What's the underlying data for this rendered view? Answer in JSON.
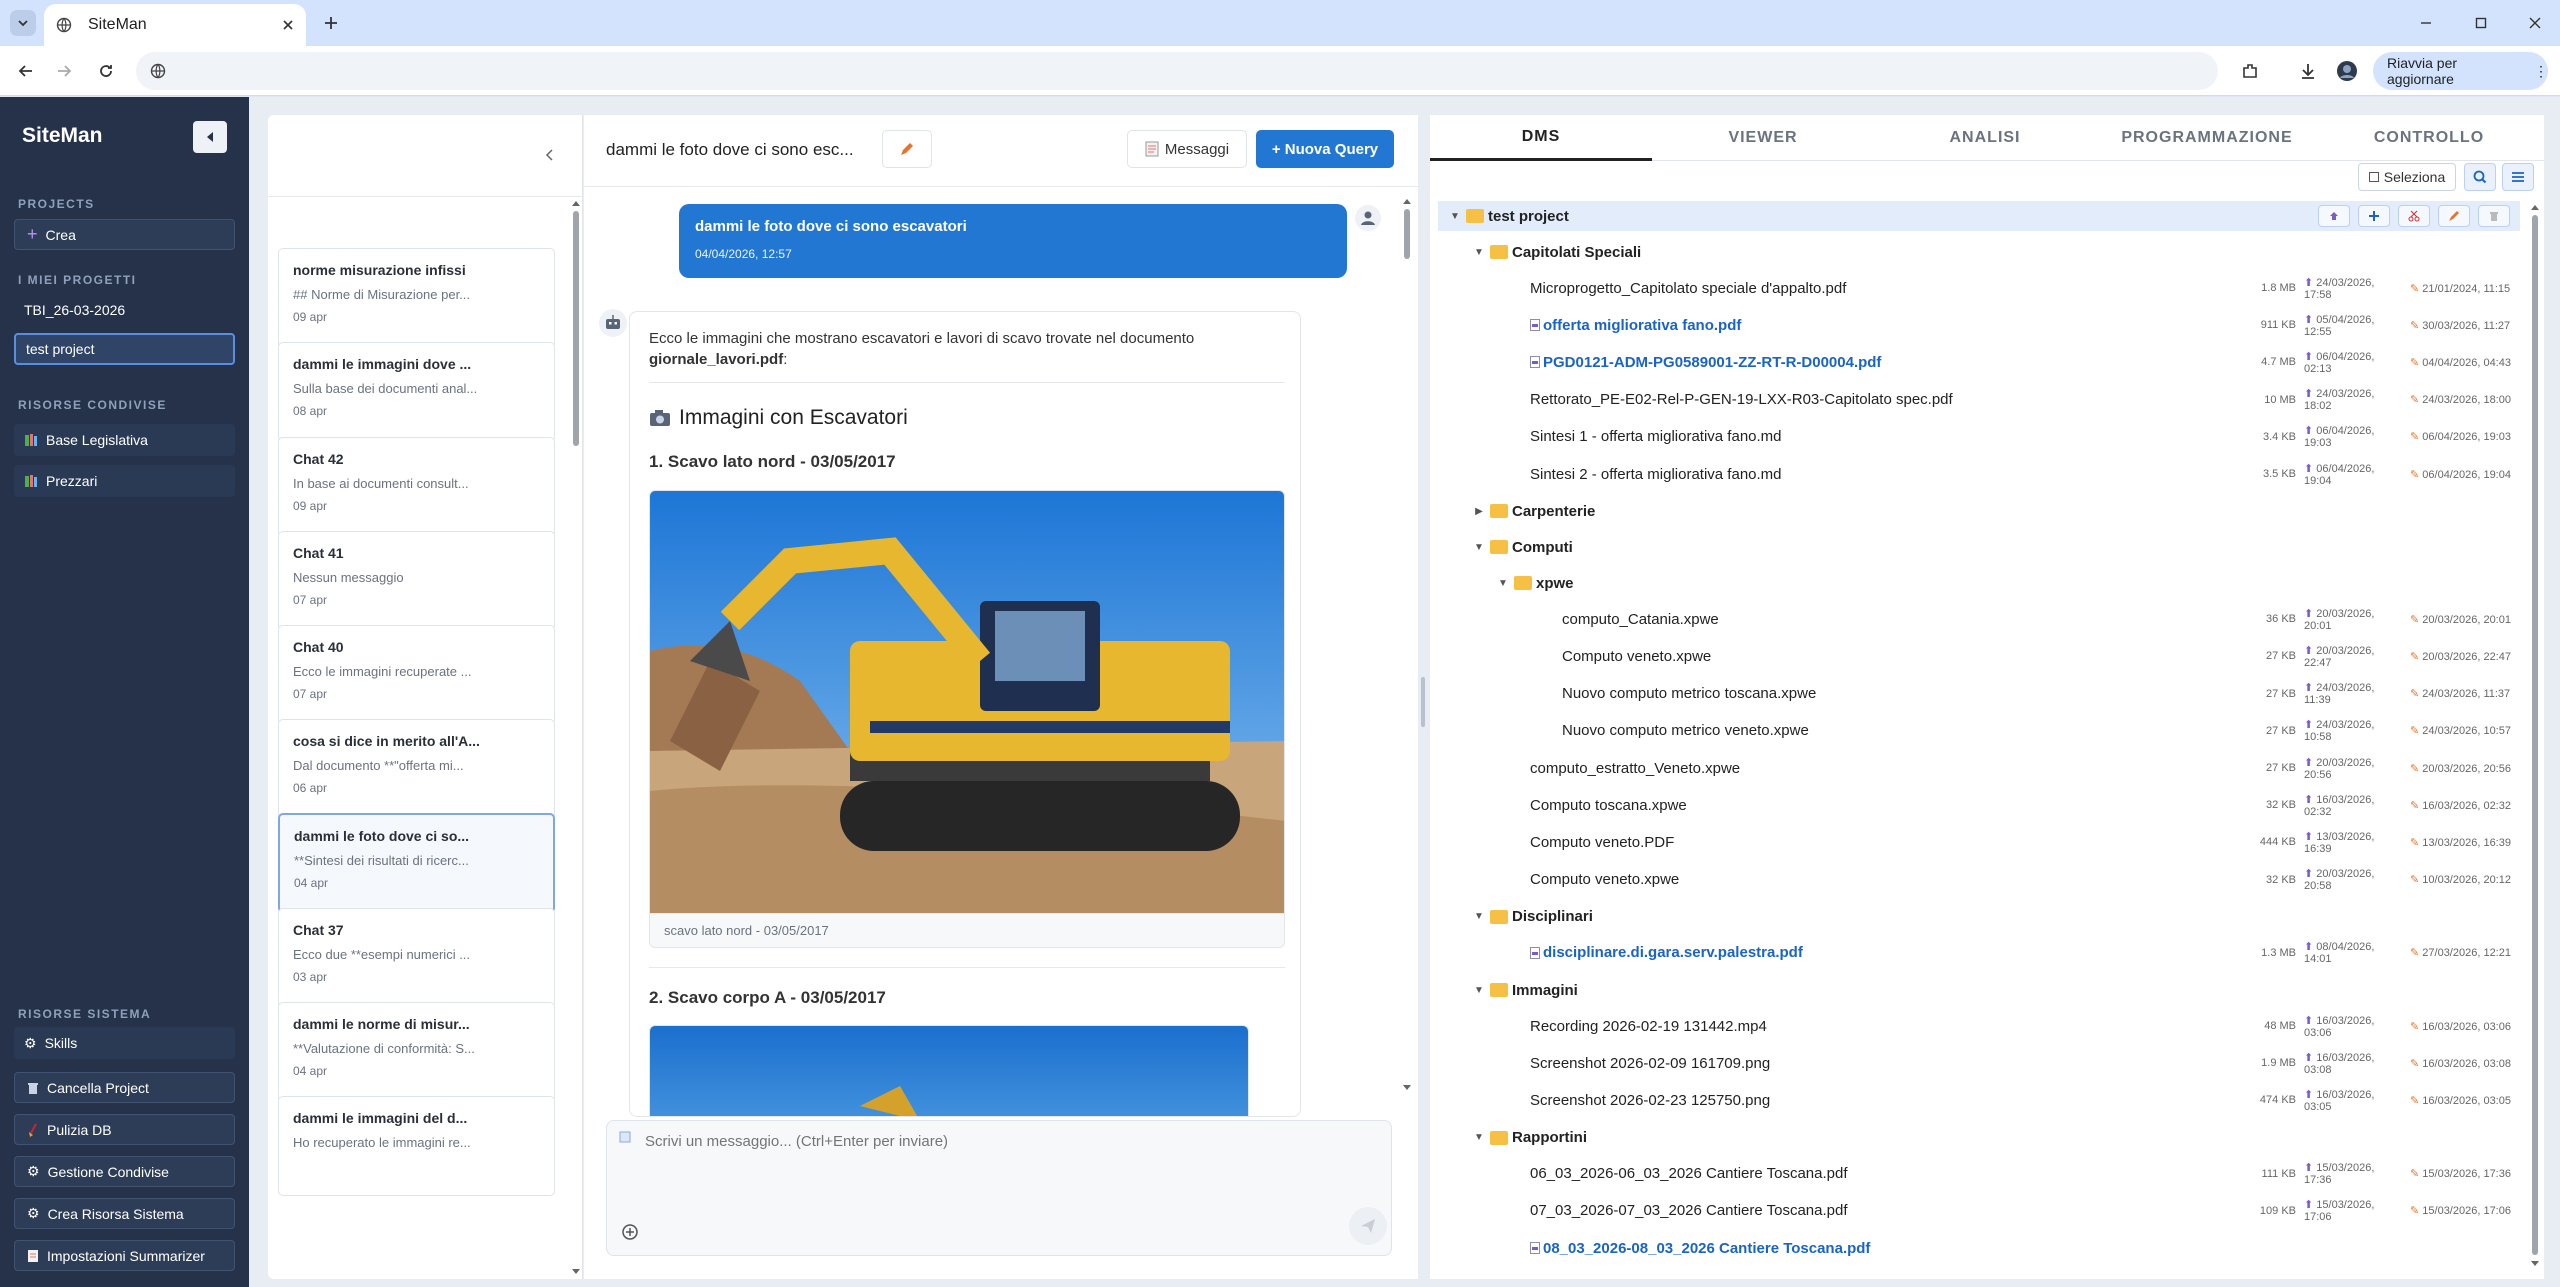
{
  "browser": {
    "tab_title": "SiteMan",
    "relaunch_label": "Riavvia per aggiornare",
    "address": ""
  },
  "sidebar": {
    "brand": "SiteMan",
    "projects_label": "PROJECTS",
    "create_label": "Crea",
    "my_projects_label": "I MIEI PROGETTI",
    "projects": [
      "TBI_26-03-2026",
      "test project"
    ],
    "shared_label": "RISORSE CONDIVISE",
    "shared": [
      "Base Legislativa",
      "Prezzari"
    ],
    "system_label": "RISORSE SISTEMA",
    "system": [
      "Skills",
      "Cancella Project",
      "Pulizia DB",
      "Gestione Condivise",
      "Crea Risorsa Sistema",
      "Impostazioni Summarizer"
    ]
  },
  "chats": [
    {
      "title": "norme misurazione infissi",
      "preview": "## Norme di Misurazione per...",
      "date": "09 apr"
    },
    {
      "title": "dammi le immagini dove ...",
      "preview": "Sulla base dei documenti anal...",
      "date": "08 apr"
    },
    {
      "title": "Chat 42",
      "preview": "In base ai documenti consult...",
      "date": "09 apr"
    },
    {
      "title": "Chat 41",
      "preview": "Nessun messaggio",
      "date": "07 apr"
    },
    {
      "title": "Chat 40",
      "preview": "Ecco le immagini recuperate ...",
      "date": "07 apr"
    },
    {
      "title": "cosa si dice in merito all'A...",
      "preview": "Dal documento **\"offerta mi...",
      "date": "06 apr"
    },
    {
      "title": "dammi le foto dove ci so...",
      "preview": "**Sintesi dei risultati di ricerc...",
      "date": "04 apr"
    },
    {
      "title": "Chat 37",
      "preview": "Ecco due **esempi numerici ...",
      "date": "03 apr"
    },
    {
      "title": "dammi le norme di misur...",
      "preview": "**Valutazione di conformità: S...",
      "date": "04 apr"
    },
    {
      "title": "dammi le immagini del d...",
      "preview": "Ho recuperato le immagini re...",
      "date": ""
    }
  ],
  "chat": {
    "title": "dammi le foto dove ci sono esc...",
    "messages_label": "Messaggi",
    "new_query_label": "+ Nuova Query",
    "user_message": "dammi le foto dove ci sono escavatori",
    "user_time": "04/04/2026, 12:57",
    "bot_intro": "Ecco le immagini che mostrano escavatori e lavori di scavo trovate nel documento",
    "bot_doc": "giornale_lavori.pdf",
    "bot_heading": "Immagini con Escavatori",
    "section1": "1. Scavo lato nord - 03/05/2017",
    "caption1": "scavo lato nord - 03/05/2017",
    "section2": "2. Scavo corpo A - 03/05/2017",
    "placeholder": "Scrivi un messaggio... (Ctrl+Enter per inviare)"
  },
  "rpanel": {
    "tabs": [
      "DMS",
      "VIEWER",
      "ANALISI",
      "PROGRAMMAZIONE",
      "CONTROLLO"
    ],
    "select_label": "Seleziona",
    "tree": [
      {
        "level": 0,
        "type": "folder",
        "name": "test project",
        "root": true
      },
      {
        "level": 1,
        "type": "folder",
        "name": "Capitolati Speciali"
      },
      {
        "level": 2,
        "type": "file",
        "name": "Microprogetto_Capitolato speciale d'appalto.pdf",
        "size": "1.8 MB",
        "uploaded": "24/03/2026, 17:58",
        "modified": "21/01/2024, 11:15"
      },
      {
        "level": 2,
        "type": "file",
        "name": "offerta migliorativa fano.pdf",
        "link": true,
        "size": "911 KB",
        "uploaded": "05/04/2026, 12:55",
        "modified": "30/03/2026, 11:27"
      },
      {
        "level": 2,
        "type": "file",
        "name": "PGD0121-ADM-PG0589001-ZZ-RT-R-D00004.pdf",
        "link": true,
        "size": "4.7 MB",
        "uploaded": "06/04/2026, 02:13",
        "modified": "04/04/2026, 04:43"
      },
      {
        "level": 2,
        "type": "file",
        "name": "Rettorato_PE-E02-Rel-P-GEN-19-LXX-R03-Capitolato spec.pdf",
        "size": "10 MB",
        "uploaded": "24/03/2026, 18:02",
        "modified": "24/03/2026, 18:00"
      },
      {
        "level": 2,
        "type": "file",
        "name": "Sintesi 1 - offerta migliorativa fano.md",
        "size": "3.4 KB",
        "uploaded": "06/04/2026, 19:03",
        "modified": "06/04/2026, 19:03"
      },
      {
        "level": 2,
        "type": "file",
        "name": "Sintesi 2 - offerta migliorativa fano.md",
        "size": "3.5 KB",
        "uploaded": "06/04/2026, 19:04",
        "modified": "06/04/2026, 19:04"
      },
      {
        "level": 1,
        "type": "folder",
        "name": "Carpenterie",
        "collapsed": true
      },
      {
        "level": 1,
        "type": "folder",
        "name": "Computi"
      },
      {
        "level": 2,
        "type": "folder",
        "name": "xpwe"
      },
      {
        "level": 3,
        "type": "file",
        "name": "computo_Catania.xpwe",
        "size": "36 KB",
        "uploaded": "20/03/2026, 20:01",
        "modified": "20/03/2026, 20:01"
      },
      {
        "level": 3,
        "type": "file",
        "name": "Computo veneto.xpwe",
        "size": "27 KB",
        "uploaded": "20/03/2026, 22:47",
        "modified": "20/03/2026, 22:47"
      },
      {
        "level": 3,
        "type": "file",
        "name": "Nuovo computo metrico toscana.xpwe",
        "size": "27 KB",
        "uploaded": "24/03/2026, 11:39",
        "modified": "24/03/2026, 11:37"
      },
      {
        "level": 3,
        "type": "file",
        "name": "Nuovo computo metrico veneto.xpwe",
        "size": "27 KB",
        "uploaded": "24/03/2026, 10:58",
        "modified": "24/03/2026, 10:57"
      },
      {
        "level": 2,
        "type": "file",
        "name": "computo_estratto_Veneto.xpwe",
        "size": "27 KB",
        "uploaded": "20/03/2026, 20:56",
        "modified": "20/03/2026, 20:56"
      },
      {
        "level": 2,
        "type": "file",
        "name": "Computo toscana.xpwe",
        "size": "32 KB",
        "uploaded": "16/03/2026, 02:32",
        "modified": "16/03/2026, 02:32"
      },
      {
        "level": 2,
        "type": "file",
        "name": "Computo veneto.PDF",
        "size": "444 KB",
        "uploaded": "13/03/2026, 16:39",
        "modified": "13/03/2026, 16:39"
      },
      {
        "level": 2,
        "type": "file",
        "name": "Computo veneto.xpwe",
        "size": "32 KB",
        "uploaded": "20/03/2026, 20:58",
        "modified": "10/03/2026, 20:12"
      },
      {
        "level": 1,
        "type": "folder",
        "name": "Disciplinari"
      },
      {
        "level": 2,
        "type": "file",
        "name": "disciplinare.di.gara.serv.palestra.pdf",
        "link": true,
        "size": "1.3 MB",
        "uploaded": "08/04/2026, 14:01",
        "modified": "27/03/2026, 12:21"
      },
      {
        "level": 1,
        "type": "folder",
        "name": "Immagini"
      },
      {
        "level": 2,
        "type": "file",
        "name": "Recording 2026-02-19 131442.mp4",
        "size": "48 MB",
        "uploaded": "16/03/2026, 03:06",
        "modified": "16/03/2026, 03:06"
      },
      {
        "level": 2,
        "type": "file",
        "name": "Screenshot 2026-02-09 161709.png",
        "size": "1.9 MB",
        "uploaded": "16/03/2026, 03:08",
        "modified": "16/03/2026, 03:08"
      },
      {
        "level": 2,
        "type": "file",
        "name": "Screenshot 2026-02-23 125750.png",
        "size": "474 KB",
        "uploaded": "16/03/2026, 03:05",
        "modified": "16/03/2026, 03:05"
      },
      {
        "level": 1,
        "type": "folder",
        "name": "Rapportini"
      },
      {
        "level": 2,
        "type": "file",
        "name": "06_03_2026-06_03_2026 Cantiere Toscana.pdf",
        "size": "111 KB",
        "uploaded": "15/03/2026, 17:36",
        "modified": "15/03/2026, 17:36"
      },
      {
        "level": 2,
        "type": "file",
        "name": "07_03_2026-07_03_2026 Cantiere Toscana.pdf",
        "size": "109 KB",
        "uploaded": "15/03/2026, 17:06",
        "modified": "15/03/2026, 17:06"
      },
      {
        "level": 2,
        "type": "file",
        "name": "08_03_2026-08_03_2026 Cantiere Toscana.pdf",
        "link": true,
        "size": "",
        "uploaded": "",
        "modified": ""
      }
    ]
  },
  "colors": {
    "accent": "#2277d2",
    "sidebar": "#25324a",
    "folder": "#f5c043",
    "link": "#1a63c7"
  }
}
